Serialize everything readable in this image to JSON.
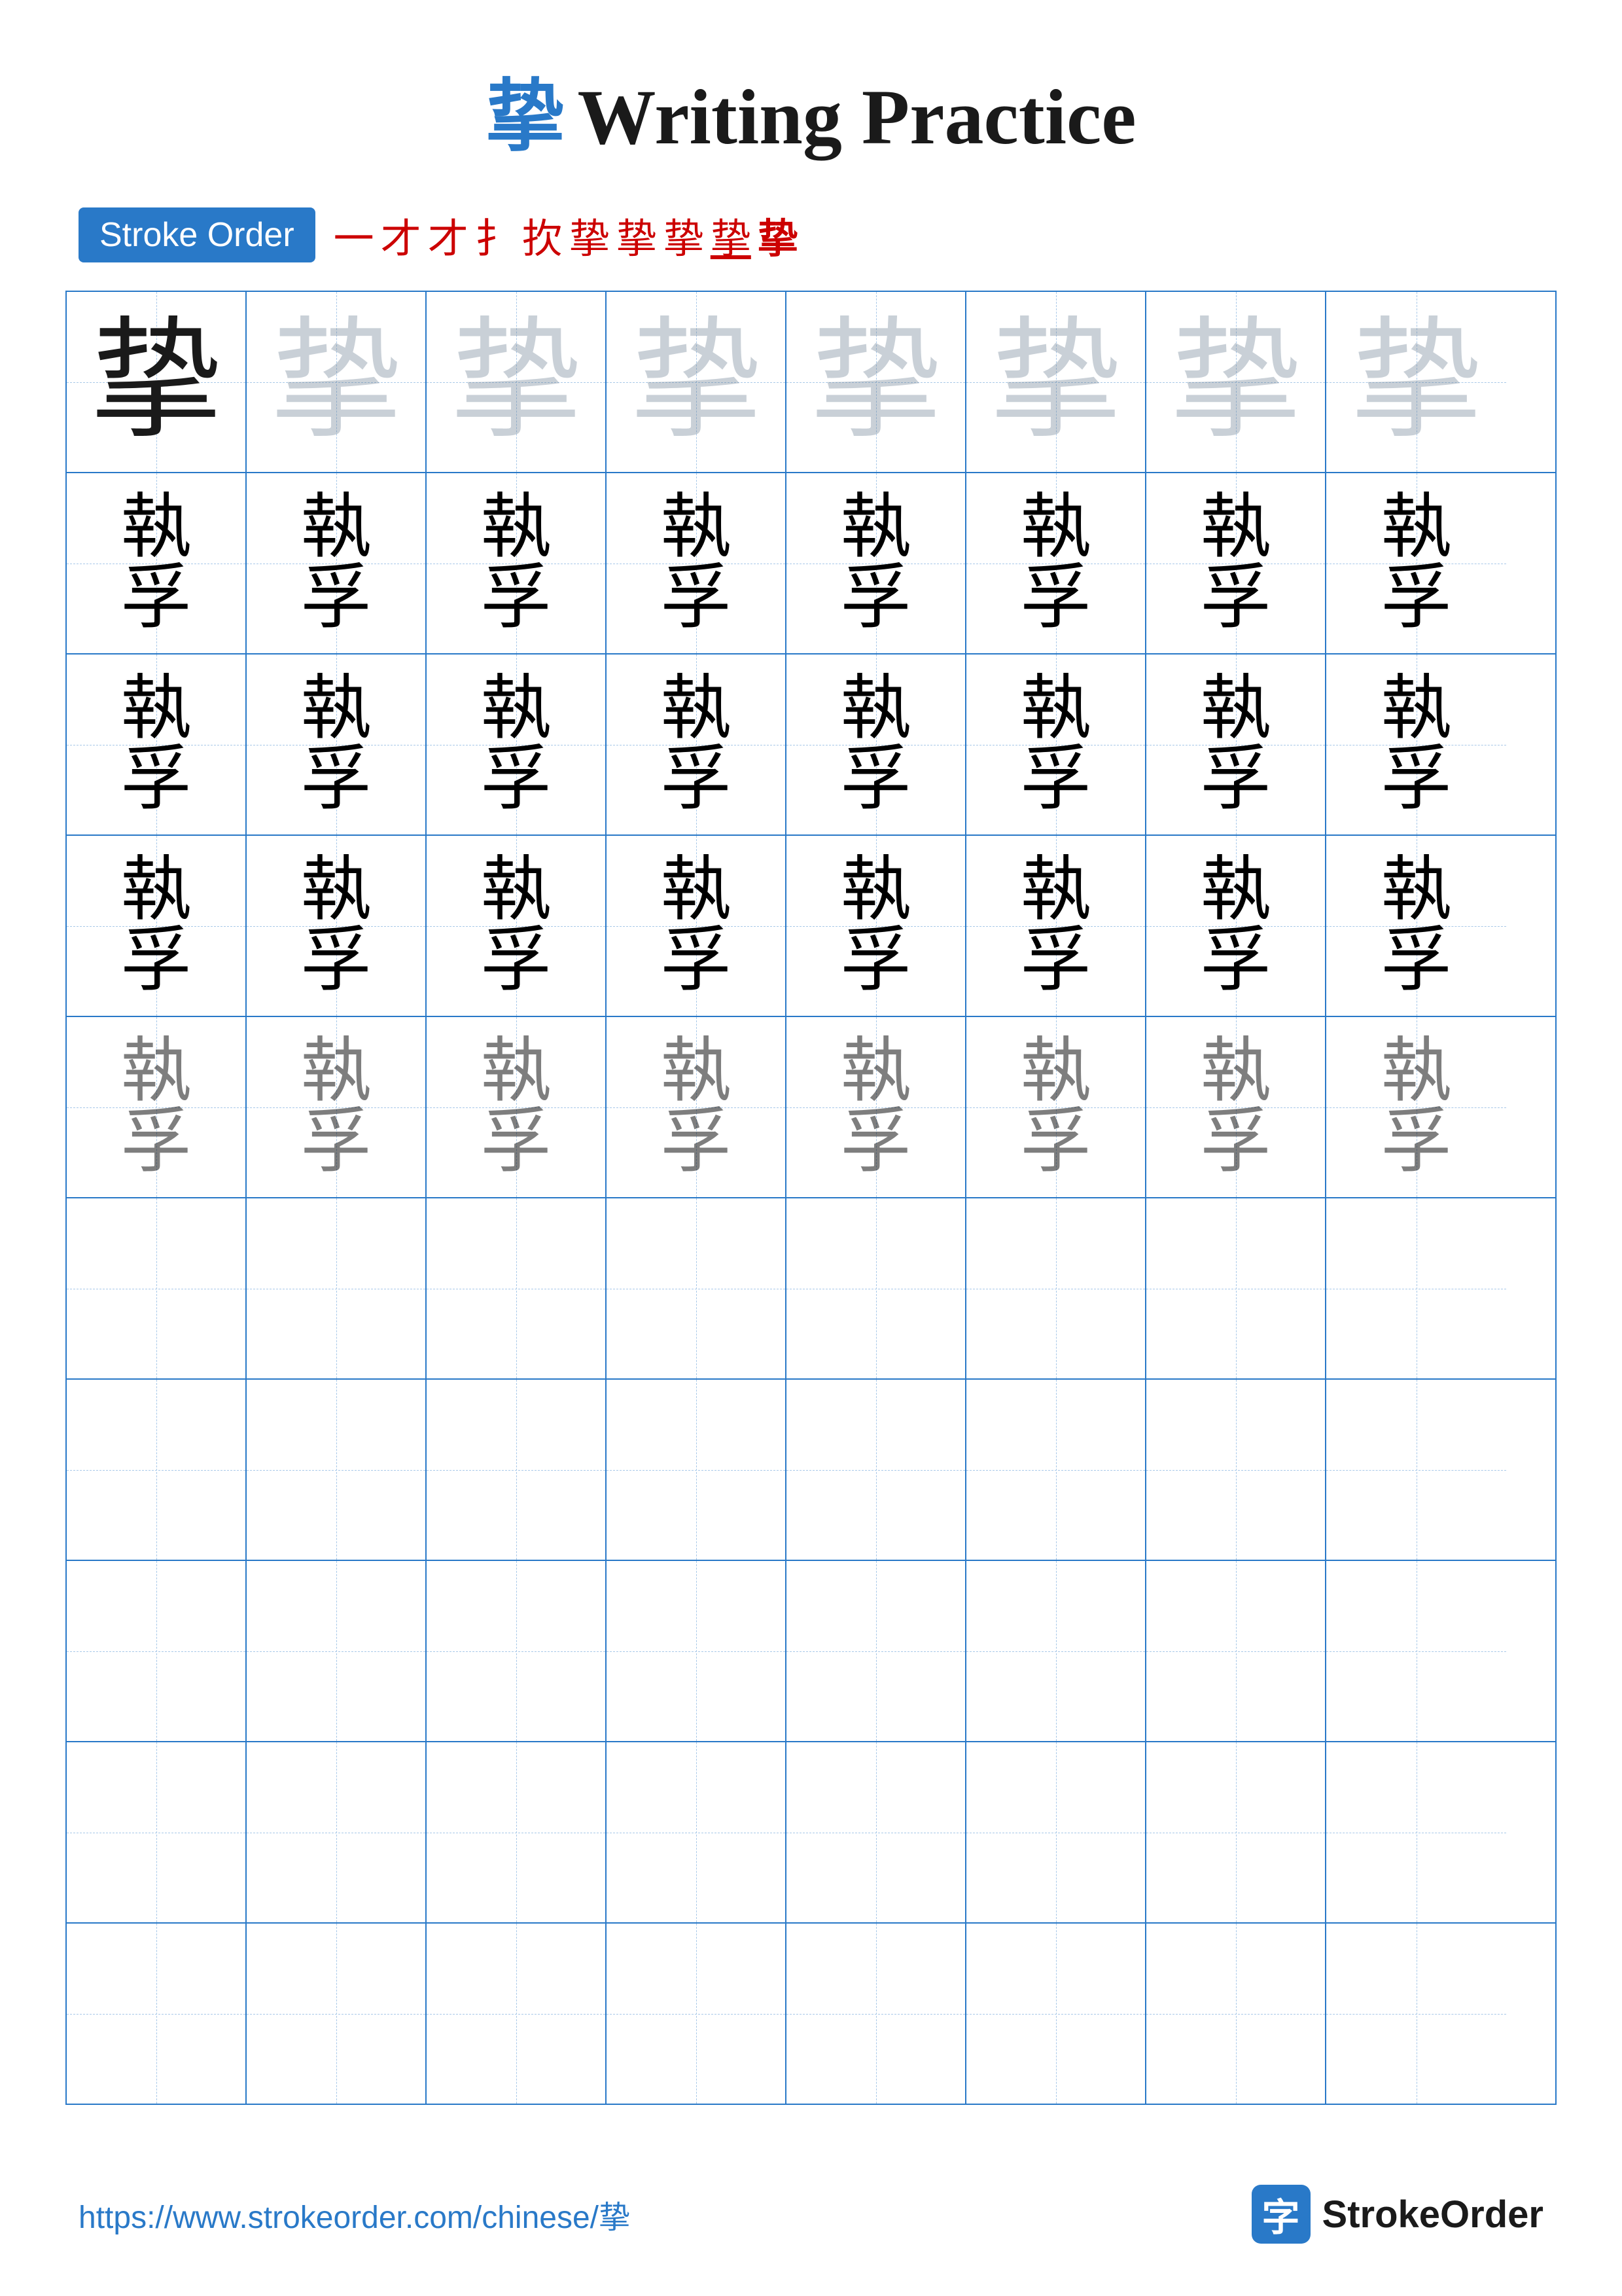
{
  "title": {
    "char": "挚",
    "text": "Writing Practice"
  },
  "stroke_order": {
    "badge": "Stroke Order",
    "chars": [
      "一",
      "才",
      "才",
      "扌",
      "扻",
      "挚",
      "挚",
      "挚",
      "挚",
      "挚"
    ]
  },
  "grid": {
    "rows": 10,
    "cols": 8,
    "char": "挚",
    "char_top": "執",
    "char_bot": "孚"
  },
  "footer": {
    "url": "https://www.strokeorder.com/chinese/挚",
    "brand_char": "字",
    "brand_text": "StrokeOrder"
  },
  "colors": {
    "blue": "#2979c8",
    "red": "#cc0000",
    "dark": "#1a1a1a",
    "light_guide": "rgba(100,120,140,0.30)"
  }
}
